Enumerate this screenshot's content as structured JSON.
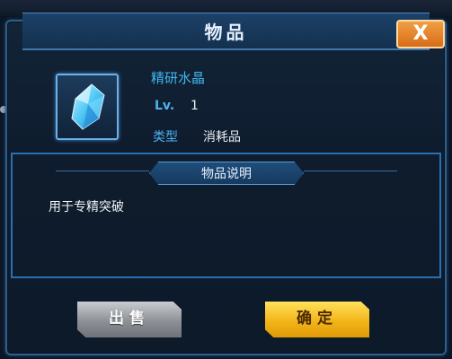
{
  "dialog": {
    "title": "物品",
    "close_label": "X"
  },
  "item": {
    "icon": "blue-crystal-icon",
    "name": "精研水晶",
    "level_label": "Lv.",
    "level_value": "1",
    "type_label": "类型",
    "type_value": "消耗品"
  },
  "description": {
    "header": "物品说明",
    "text": "用于专精突破"
  },
  "buttons": {
    "sell_label": "出售",
    "confirm_label": "确定"
  },
  "colors": {
    "accent_blue": "#3fb7ef",
    "confirm_gold": "#f3b41a",
    "close_orange": "#d86c18"
  }
}
